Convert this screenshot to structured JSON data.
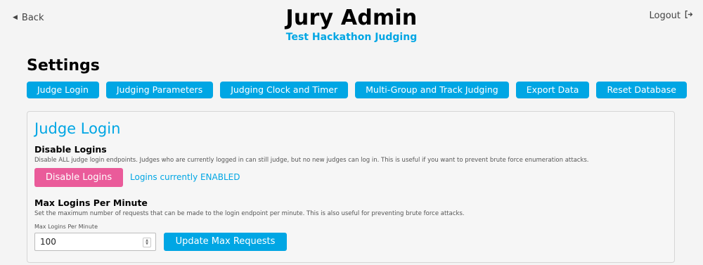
{
  "header": {
    "back_label": "Back",
    "logout_label": "Logout",
    "title": "Jury Admin",
    "subtitle": "Test Hackathon Judging"
  },
  "settings": {
    "heading": "Settings",
    "tabs": [
      {
        "label": "Judge Login"
      },
      {
        "label": "Judging Parameters"
      },
      {
        "label": "Judging Clock and Timer"
      },
      {
        "label": "Multi-Group and Track Judging"
      },
      {
        "label": "Export Data"
      },
      {
        "label": "Reset Database"
      }
    ]
  },
  "judge_login": {
    "title": "Judge Login",
    "disable": {
      "title": "Disable Logins",
      "description": "Disable ALL judge login endpoints. Judges who are currently logged in can still judge, but no new judges can log in. This is useful if you want to prevent brute force enumeration attacks.",
      "button_label": "Disable Logins",
      "status": "Logins currently ENABLED"
    },
    "max_logins": {
      "title": "Max Logins Per Minute",
      "description": "Set the maximum number of requests that can be made to the login endpoint per minute. This is also useful for preventing brute force attacks.",
      "field_label": "Max Logins Per Minute",
      "value": "100",
      "button_label": "Update Max Requests"
    }
  },
  "colors": {
    "accent": "#00a6e4",
    "danger": "#ea5b9a"
  },
  "icons": {
    "back": "triangle-left-icon",
    "logout": "logout-icon",
    "spinner": "number-spinner-icon"
  }
}
